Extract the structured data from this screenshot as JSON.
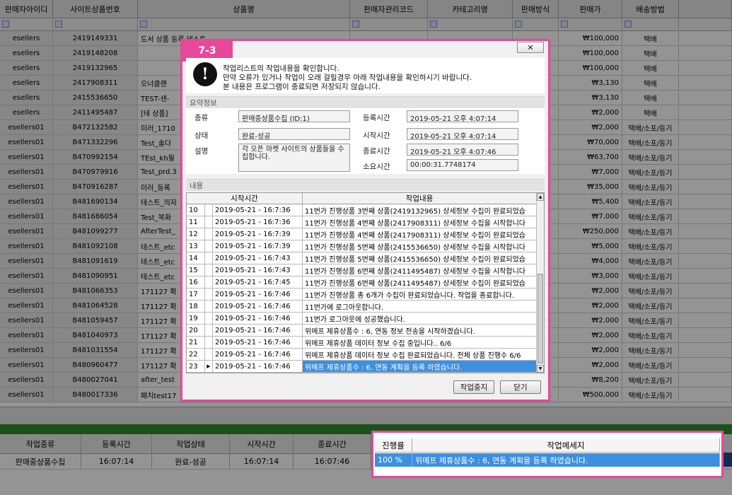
{
  "background": {
    "columns": [
      "판매자아이디",
      "사이트상품번호",
      "상품명",
      "판매자관리코드",
      "카테고리명",
      "판매방식",
      "판매가",
      "배송방법"
    ],
    "rows": [
      [
        "esellers",
        "2419149331",
        "도서 상품 등록 테스트",
        "",
        "",
        "",
        "₩100,000",
        "택배"
      ],
      [
        "esellers",
        "2419148208",
        "",
        "",
        "",
        "",
        "₩100,000",
        "택배"
      ],
      [
        "esellers",
        "2419132965",
        "",
        "",
        "",
        "",
        "₩100,000",
        "택배"
      ],
      [
        "esellers",
        "2417908311",
        "오너클랜 ",
        "",
        "",
        "",
        "₩3,130",
        "택배"
      ],
      [
        "esellers",
        "2415536650",
        "TEST-샌-",
        "",
        "",
        "",
        "₩3,130",
        "택배"
      ],
      [
        "esellers",
        "2411495487",
        "[테 상품]",
        "",
        "",
        "",
        "₩2,000",
        "택배"
      ],
      [
        "esellers01",
        "B472132582",
        "미러_1710",
        "",
        "",
        "",
        "₩2,000",
        "택배/소포/등기"
      ],
      [
        "esellers01",
        "B471332296",
        "Test_솔다",
        "",
        "",
        "",
        "₩70,000",
        "택배/소포/등기"
      ],
      [
        "esellers01",
        "B470992154",
        "TEst_kh월",
        "",
        "",
        "",
        "₩63,700",
        "택배/소포/등기"
      ],
      [
        "esellers01",
        "B470979916",
        "Test_prd.3",
        "",
        "",
        "",
        "₩7,000",
        "택배/소포/등기"
      ],
      [
        "esellers01",
        "B470916287",
        "미러_등록",
        "",
        "",
        "",
        "₩35,000",
        "택배/소포/등기"
      ],
      [
        "esellers01",
        "B481690134",
        "테스트_의자",
        "",
        "",
        "",
        "₩5,400",
        "택배/소포/등기"
      ],
      [
        "esellers01",
        "B481686054",
        "Test_복화",
        "",
        "",
        "",
        "₩7,000",
        "택배/소포/등기"
      ],
      [
        "esellers01",
        "B481099277",
        "AfterTest_",
        "",
        "",
        "",
        "₩250,000",
        "택배/소포/등기"
      ],
      [
        "esellers01",
        "B481092108",
        "테스트_etc",
        "",
        "",
        "",
        "₩5,000",
        "택배/소포/등기"
      ],
      [
        "esellers01",
        "B481091619",
        "테스트_etc",
        "",
        "",
        "",
        "₩4,000",
        "택배/소포/등기"
      ],
      [
        "esellers01",
        "B481090951",
        "테스트_etc",
        "",
        "",
        "",
        "₩3,000",
        "택배/소포/등기"
      ],
      [
        "esellers01",
        "B481066353",
        "171127 확",
        "",
        "",
        "",
        "₩2,000",
        "택배/소포/등기"
      ],
      [
        "esellers01",
        "B481064528",
        "171127 확",
        "",
        "",
        "",
        "₩2,000",
        "택배/소포/등기"
      ],
      [
        "esellers01",
        "B481059457",
        "171127 확",
        "",
        "",
        "",
        "₩2,000",
        "택배/소포/등기"
      ],
      [
        "esellers01",
        "B481040973",
        "171127 확",
        "",
        "",
        "",
        "₩2,000",
        "택배/소포/등기"
      ],
      [
        "esellers01",
        "B481031554",
        "171127 확",
        "",
        "",
        "",
        "₩2,000",
        "택배/소포/등기"
      ],
      [
        "esellers01",
        "B480960477",
        "171127 확",
        "",
        "",
        "",
        "₩2,000",
        "택배/소포/등기"
      ],
      [
        "esellers01",
        "B480027041",
        "after_test",
        "",
        "",
        "",
        "₩8,200",
        "택배/소포/등기"
      ],
      [
        "esellers01",
        "B480017336",
        "패치test17",
        "",
        "",
        "",
        "₩500,000",
        "택배/소포/등기"
      ]
    ],
    "bottom_columns": [
      "작업종류",
      "등록시간",
      "작업상태",
      "시작시간",
      "종료시간"
    ],
    "bottom_row": [
      "판매중상품수집",
      "16:07:14",
      "완료-성공",
      "16:07:14",
      "16:07:46"
    ]
  },
  "dialog": {
    "badge": "7-3",
    "close": "✕",
    "message_lines": [
      "작업리스트의 작업내용을 확인합니다.",
      "만약 오류가 있거나 작업이 오래 걸릴경우 아래 작업내용을 확인하시기 바랍니다.",
      "본 내용은 프로그램이 종료되면 저장되지 않습니다."
    ],
    "summary_title": "요약정보",
    "summary": {
      "type_label": "종류",
      "type_value": "판매중상품수집 (ID:1)",
      "status_label": "상태",
      "status_value": "완료-성공",
      "desc_label": "설명",
      "desc_value": "각 오픈 마켓 사이트의 상품들을 수집합니다.",
      "reg_label": "등록시간",
      "reg_value": "2019-05-21 오후 4:07:14",
      "start_label": "시작시간",
      "start_value": "2019-05-21 오후 4:07:14",
      "end_label": "종료시간",
      "end_value": "2019-05-21 오후 4:07:46",
      "elapsed_label": "소요시간",
      "elapsed_value": "00:00:31.7748174"
    },
    "content_title": "내용",
    "log_columns": [
      "시작시간",
      "작업내용"
    ],
    "log_rows": [
      {
        "n": "10",
        "t": "2019-05-21  -  16:7:36",
        "m": "11번가 진행상품 3번째 상품(2419132965) 상세정보 수집이 완료되었습"
      },
      {
        "n": "11",
        "t": "2019-05-21  -  16:7:36",
        "m": "11번가 진행상품 4번째 상품(2417908311) 상세정보 수집을 시작합니다"
      },
      {
        "n": "12",
        "t": "2019-05-21  -  16:7:39",
        "m": "11번가 진행상품 4번째 상품(2417908311) 상세정보 수집이 완료되었습"
      },
      {
        "n": "13",
        "t": "2019-05-21  -  16:7:39",
        "m": "11번가 진행상품 5번째 상품(2415536650) 상세정보 수집을 시작합니다"
      },
      {
        "n": "14",
        "t": "2019-05-21  -  16:7:43",
        "m": "11번가 진행상품 5번째 상품(2415536650) 상세정보 수집이 완료되었습"
      },
      {
        "n": "15",
        "t": "2019-05-21  -  16:7:43",
        "m": "11번가 진행상품 6번째 상품(2411495487) 상세정보 수집을 시작합니다"
      },
      {
        "n": "16",
        "t": "2019-05-21  -  16:7:45",
        "m": "11번가 진행상품 6번째 상품(2411495487) 상세정보 수집이 완료되었습"
      },
      {
        "n": "17",
        "t": "2019-05-21  -  16:7:46",
        "m": "11번가 진행상품 총 6개가 수집이 완료되었습니다. 작업을 종료합니다."
      },
      {
        "n": "18",
        "t": "2019-05-21  -  16:7:46",
        "m": "11번가에 로그아웃합니다."
      },
      {
        "n": "19",
        "t": "2019-05-21  -  16:7:46",
        "m": "11번가 로그아웃에 성공했습니다."
      },
      {
        "n": "20",
        "t": "2019-05-21  -  16:7:46",
        "m": "위메프 제휴상품수 : 6, 연동 정보 전송을 시작하겠습니다."
      },
      {
        "n": "21",
        "t": "2019-05-21  -  16:7:46",
        "m": "위메프 제휴상품 데이터 정보 수집 중입니다.. 6/6"
      },
      {
        "n": "22",
        "t": "2019-05-21  -  16:7:46",
        "m": "위메프 제휴상품 데이터 정보 수집 완료되었습니다. 전체 상품 진행수 6/6"
      },
      {
        "n": "23",
        "t": "2019-05-21  -  16:7:46",
        "m": "위메프 제휴상품수 : 6, 연동 계획을 등록 하였습니다."
      }
    ],
    "stop_button": "작업중지",
    "close_button": "닫기"
  },
  "progress_panel": {
    "col_progress": "진행률",
    "col_message": "작업메세지",
    "progress": "100 %",
    "message": "위메프 제휴상품수 : 6, 연동 계획을 등록 하였습니다."
  },
  "colors": {
    "highlight": "#e8479a",
    "selection": "#3d8fe0"
  }
}
